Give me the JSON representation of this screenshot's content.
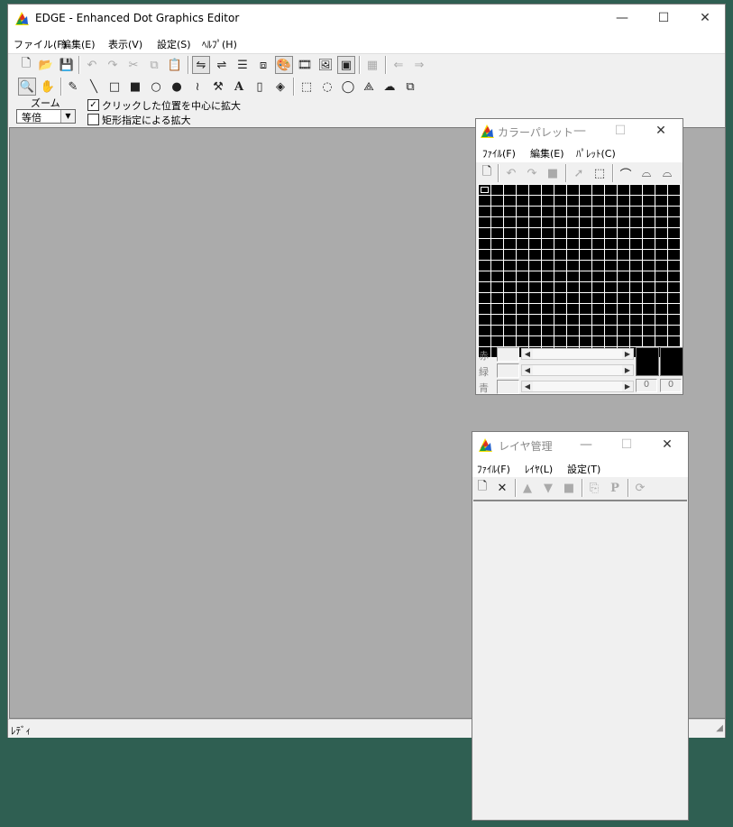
{
  "main_window": {
    "title": "EDGE - Enhanced Dot Graphics Editor",
    "menu": [
      "ファイル(F)",
      "編集(E)",
      "表示(V)",
      "設定(S)",
      "ﾍﾙﾌﾟ(H)"
    ],
    "zoom_label": "ズーム",
    "zoom_value": "等倍",
    "option_center_zoom": "クリックした位置を中心に拡大",
    "option_center_zoom_checked": true,
    "option_rect_zoom": "矩形指定による拡大",
    "option_rect_zoom_checked": false,
    "status": "ﾚﾃﾞｨ",
    "canvas_color": "#ababab"
  },
  "palette_window": {
    "title": "カラーパレット",
    "menu": [
      "ﾌｧｲﾙ(F)",
      "編集(E)",
      "ﾊﾟﾚｯﾄ(C)"
    ],
    "rgb_labels": [
      "赤",
      "緑",
      "青"
    ],
    "index_values": [
      "0",
      "0"
    ],
    "swatch_color": "#000000",
    "grid_rows": 16,
    "grid_cols": 16
  },
  "layer_window": {
    "title": "レイヤ管理",
    "menu": [
      "ﾌｧｲﾙ(F)",
      "ﾚｲﾔ(L)",
      "設定(T)"
    ]
  },
  "icons": {
    "toolbar1": [
      "new-file-icon",
      "open-folder-icon",
      "save-icon",
      "undo-icon",
      "redo-icon",
      "cut-icon",
      "copy-icon",
      "paste-icon",
      "flip-h-icon",
      "flip-v-icon",
      "line-pattern-icon",
      "resize-icon",
      "palette-icon",
      "film-icon",
      "image-icon",
      "screen-icon",
      "grid-icon",
      "back-icon",
      "forward-icon"
    ],
    "toolbar2": [
      "zoom-icon",
      "hand-icon",
      "pencil-icon",
      "line-icon",
      "rect-icon",
      "filled-rect-icon",
      "ellipse-icon",
      "filled-ellipse-icon",
      "curve-icon",
      "hammer-icon",
      "text-icon",
      "spray-icon",
      "fill-icon",
      "rect-select-icon",
      "ellipse-select-icon",
      "lasso-icon",
      "polygon-select-icon",
      "cloud-select-icon",
      "move-select-icon"
    ]
  }
}
